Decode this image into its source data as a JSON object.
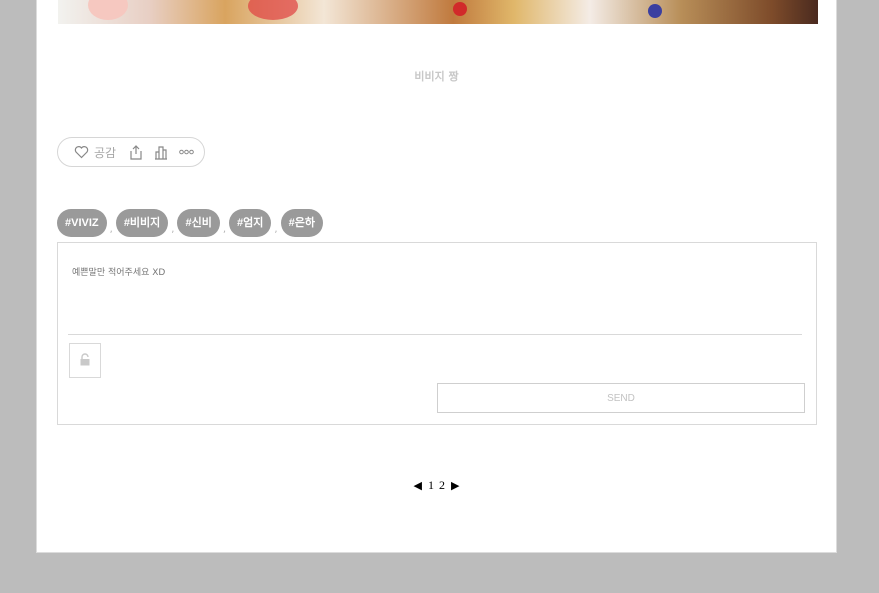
{
  "post": {
    "caption": "비비지 짱",
    "actions": {
      "like_label": "공감",
      "icons": [
        "heart-icon",
        "share-icon",
        "stats-icon",
        "more-icon"
      ]
    },
    "tags": [
      "#VIVIZ",
      "#비비지",
      "#신비",
      "#엄지",
      "#은하"
    ],
    "tag_separator": ","
  },
  "comment_form": {
    "placeholder": "예쁜말만 적어주세요 XD",
    "send_label": "SEND"
  },
  "pagination": {
    "prev": "◀",
    "pages": [
      "1",
      "2"
    ],
    "next": "▶"
  },
  "colors": {
    "page_bg": "#bcbcbc",
    "tag_bg": "#9a9a9a"
  }
}
